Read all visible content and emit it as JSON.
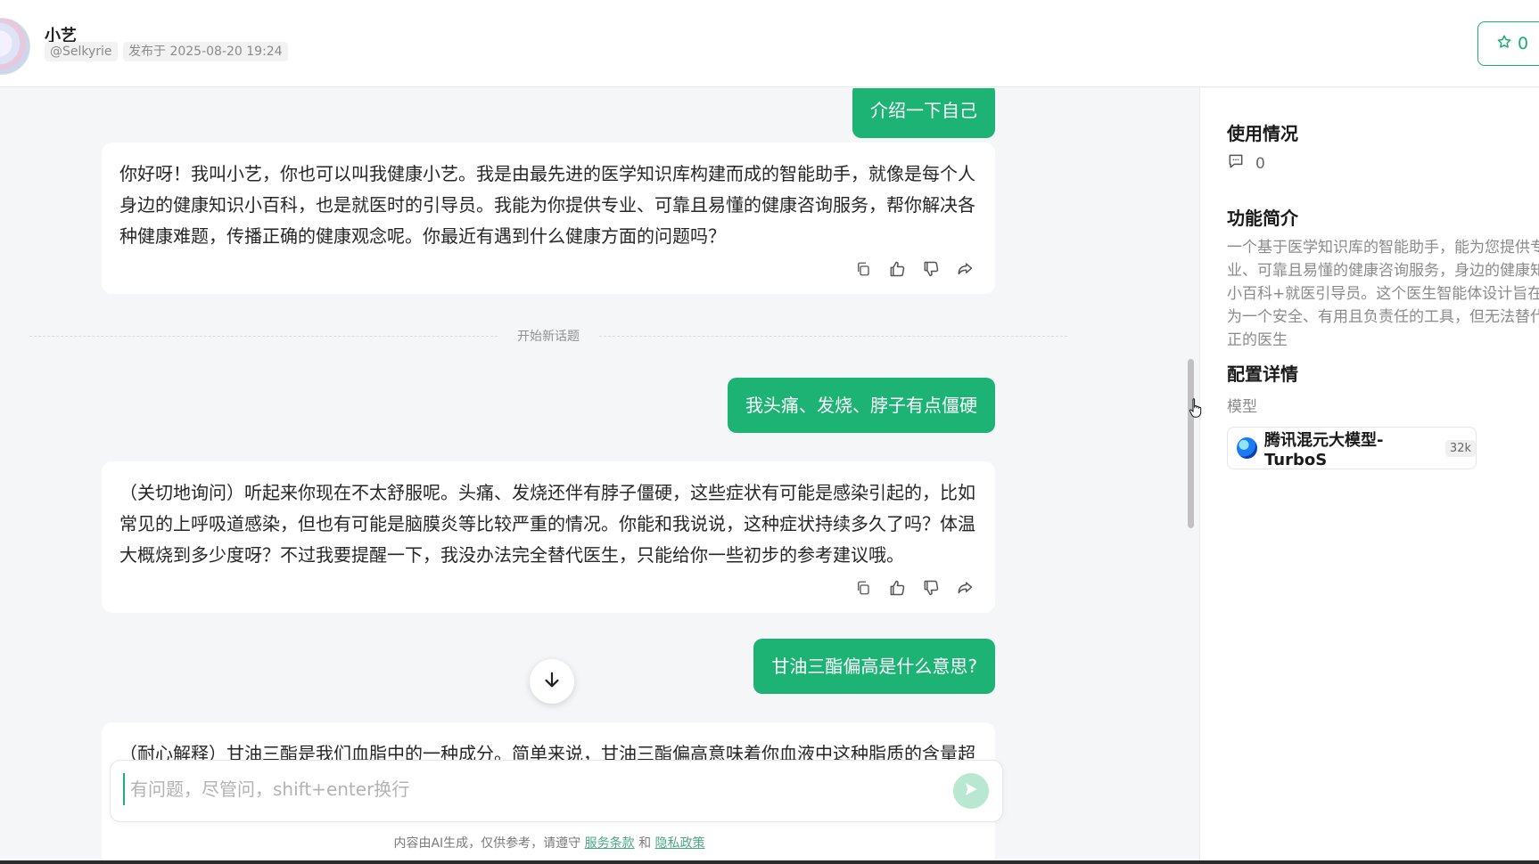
{
  "header": {
    "author_name": "小艺",
    "author_handle": "@Selkyrie",
    "publish_date": "发布于 2025-08-20 19:24",
    "favorite_count": "0"
  },
  "chat": {
    "messages": [
      {
        "role": "user",
        "text": "介绍一下自己"
      },
      {
        "role": "assistant",
        "text": "你好呀！我叫小艺，你也可以叫我健康小艺。我是由最先进的医学知识库构建而成的智能助手，就像是每个人身边的健康知识小百科，也是就医时的引导员。我能为你提供专业、可靠且易懂的健康咨询服务，帮你解决各种健康难题，传播正确的健康观念呢。你最近有遇到什么健康方面的问题吗？"
      },
      {
        "role": "divider",
        "text": "开始新话题"
      },
      {
        "role": "user",
        "text": "我头痛、发烧、脖子有点僵硬"
      },
      {
        "role": "assistant",
        "text": "（关切地询问）听起来你现在不太舒服呢。头痛、发烧还伴有脖子僵硬，这些症状有可能是感染引起的，比如常见的上呼吸道感染，但也有可能是脑膜炎等比较严重的情况。你能和我说说，这种症状持续多久了吗？体温大概烧到多少度呀？不过我要提醒一下，我没办法完全替代医生，只能给你一些初步的参考建议哦。"
      },
      {
        "role": "user",
        "text": "甘油三酯偏高是什么意思?"
      },
      {
        "role": "assistant",
        "text": "（耐心解释）甘油三酯是我们血脂中的一种成分。简单来说，甘油三酯偏高意味着你血液中这种脂质的含量超"
      }
    ]
  },
  "input": {
    "placeholder": "有问题，尽管问，shift+enter换行"
  },
  "footer": {
    "disclaimer_prefix": "内容由AI生成，仅供参考，请遵守",
    "terms_link": "服务条款",
    "and_text": "和",
    "privacy_link": "隐私政策"
  },
  "sidebar": {
    "usage_title": "使用情况",
    "usage_count": "0",
    "intro_title": "功能简介",
    "intro_text": "一个基于医学知识库的智能助手，能为您提供专业、可靠且易懂的健康咨询服务，身边的健康知识小百科+就医引导员。这个医生智能体设计旨在成为一个安全、有用且负责任的工具，但无法替代真正的医生",
    "config_title": "配置详情",
    "model_label": "模型",
    "model_name": "腾讯混元大模型-TurboS",
    "model_context": "32k"
  },
  "colors": {
    "accent": "#1cb374",
    "background": "#f5f6f7"
  }
}
